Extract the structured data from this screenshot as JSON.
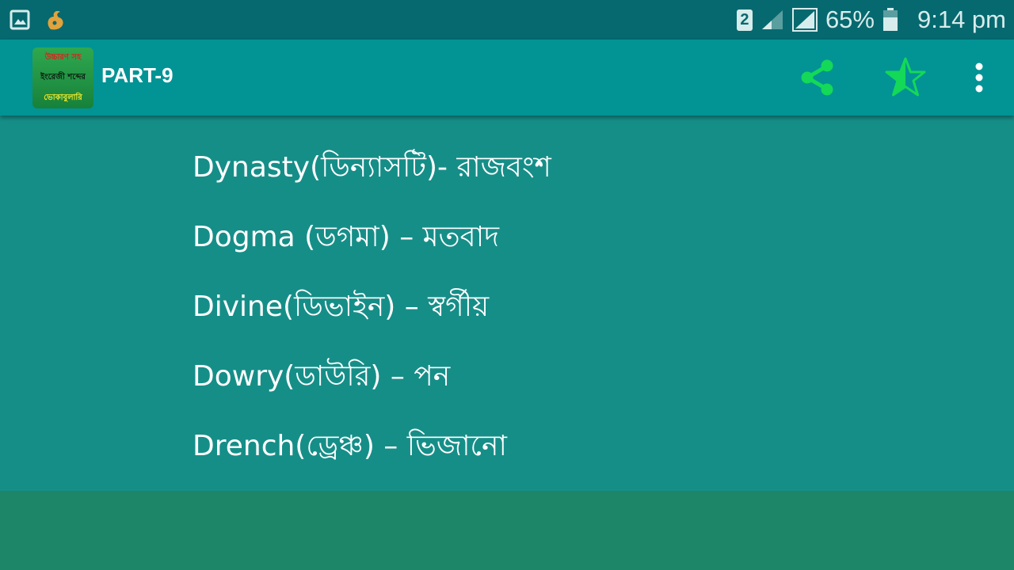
{
  "status_bar": {
    "sim_badge": "2",
    "battery": "65%",
    "time": "9:14 pm",
    "icons": [
      "gallery-icon",
      "squirrel-app-icon",
      "sim-2-icon",
      "signal-icon",
      "signal-icon",
      "battery-icon"
    ]
  },
  "app_bar": {
    "logo_lines": [
      "উচ্চারণ সহ",
      "ইংরেজী শব্দের",
      "ভোকাবুলারি"
    ],
    "title": "PART-9",
    "actions": [
      "share-icon",
      "rate-star-icon",
      "overflow-menu-icon"
    ]
  },
  "vocab": [
    "Dynasty(ডিন্যাসটি)- রাজবংশ",
    "Dogma (ডগমা) – মতবাদ",
    "Divine(ডিভাইন) – স্বর্গীয়",
    "Dowry(ডাউরি) – পন",
    "Drench(ড্রেঞ্চ) – ভিজানো"
  ],
  "colors": {
    "status_bar": "#06696f",
    "app_bar": "#029395",
    "content": "#168e88",
    "bottom": "#1e8668",
    "accent_green": "#14d858"
  }
}
